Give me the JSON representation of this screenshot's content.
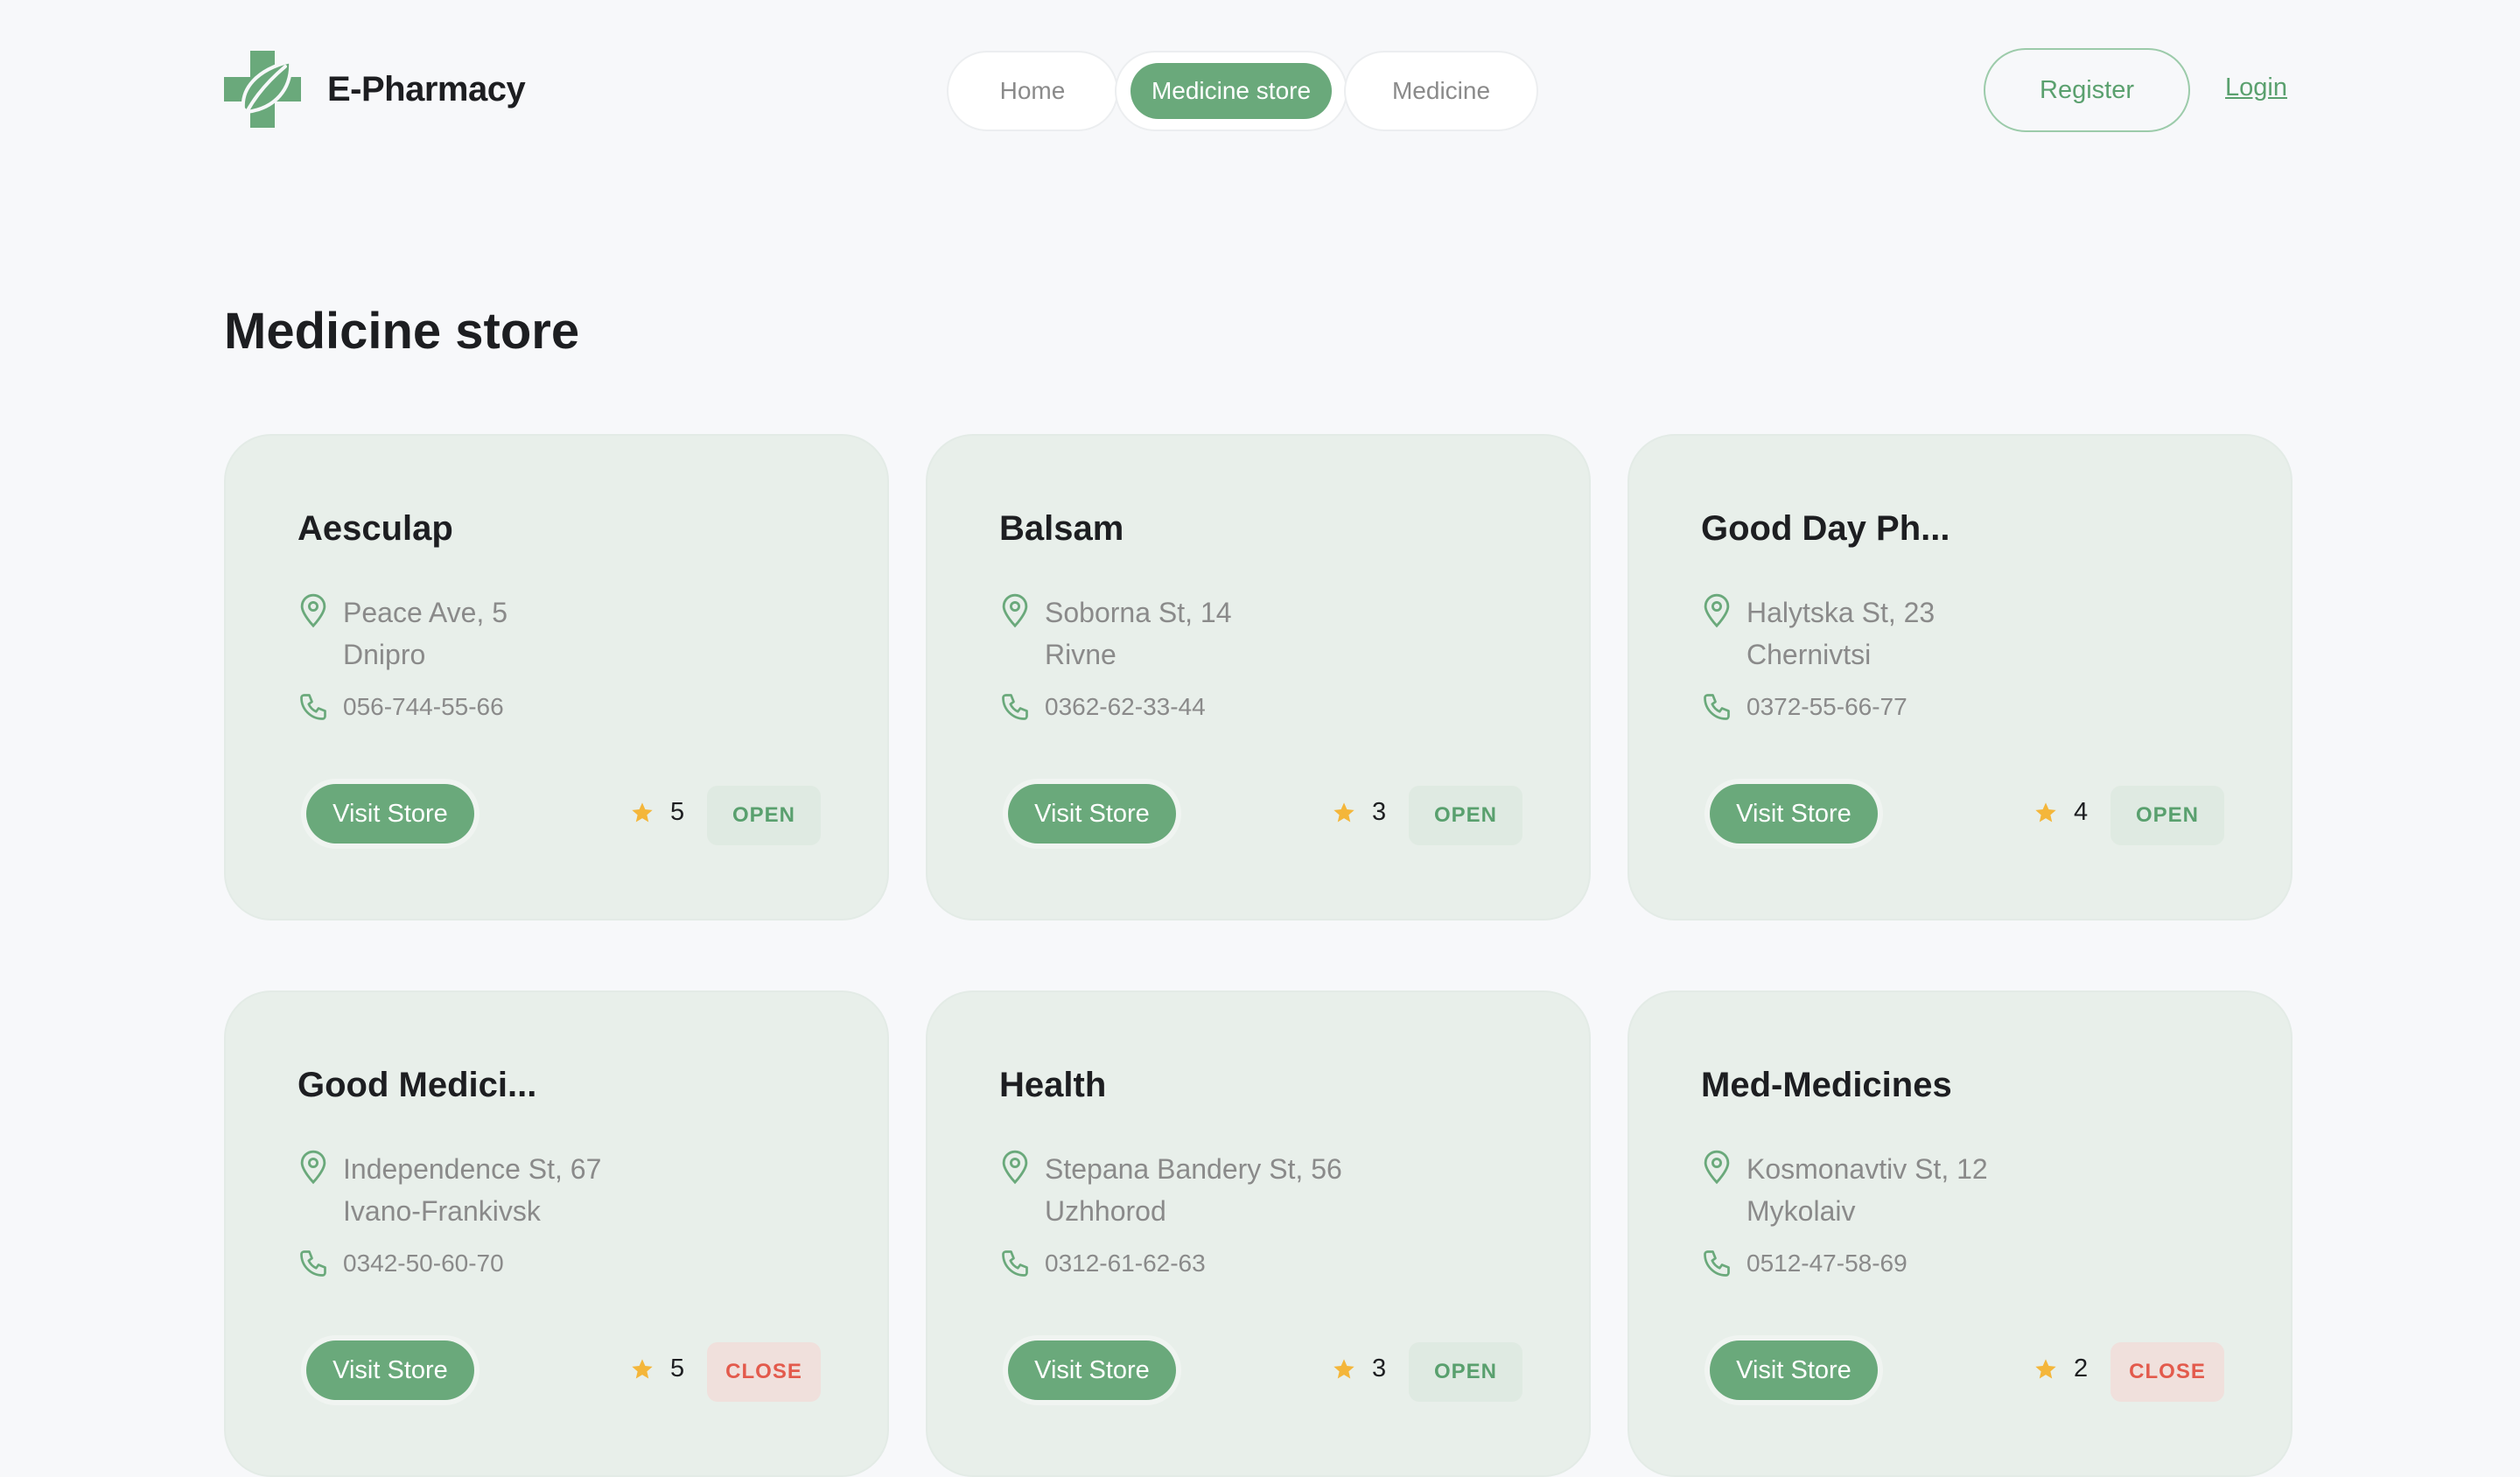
{
  "app": {
    "brand": "E-Pharmacy",
    "accent": "#6aa97b",
    "open_color": "#59a06e",
    "close_color": "#e35a4c"
  },
  "nav": {
    "home": "Home",
    "store": "Medicine store",
    "medicine": "Medicine"
  },
  "auth": {
    "register": "Register",
    "login": "Login"
  },
  "page": {
    "title": "Medicine store"
  },
  "stores": [
    {
      "name": "Aesculap",
      "street": "Peace Ave, 5",
      "city": "Dnipro",
      "phone": "056-744-55-66",
      "rating": "5",
      "status": "OPEN",
      "visit_label": "Visit Store"
    },
    {
      "name": "Balsam",
      "street": "Soborna St, 14",
      "city": "Rivne",
      "phone": "0362-62-33-44",
      "rating": "3",
      "status": "OPEN",
      "visit_label": "Visit Store"
    },
    {
      "name": "Good Day Ph...",
      "street": "Halytska St, 23",
      "city": "Chernivtsi",
      "phone": "0372-55-66-77",
      "rating": "4",
      "status": "OPEN",
      "visit_label": "Visit Store"
    },
    {
      "name": "Good Medici...",
      "street": "Independence St, 67",
      "city": "Ivano-Frankivsk",
      "phone": "0342-50-60-70",
      "rating": "5",
      "status": "CLOSE",
      "visit_label": "Visit Store"
    },
    {
      "name": "Health",
      "street": "Stepana Bandery St, 56",
      "city": "Uzhhorod",
      "phone": "0312-61-62-63",
      "rating": "3",
      "status": "OPEN",
      "visit_label": "Visit Store"
    },
    {
      "name": "Med-Medicines",
      "street": "Kosmonavtiv St, 12",
      "city": "Mykolaiv",
      "phone": "0512-47-58-69",
      "rating": "2",
      "status": "CLOSE",
      "visit_label": "Visit Store"
    }
  ],
  "icons": {
    "logo": "leaf-cross-icon",
    "address": "map-pin-icon",
    "phone": "phone-icon",
    "rating": "star-icon"
  }
}
